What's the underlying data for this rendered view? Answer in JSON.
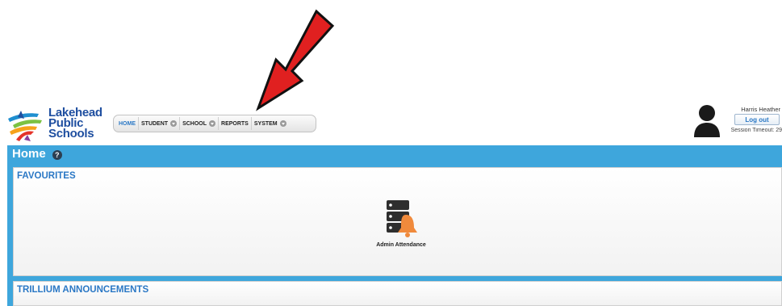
{
  "logo": {
    "line1": "Lakehead",
    "line2": "Public",
    "line3": "Schools"
  },
  "nav": {
    "items": [
      {
        "label": "HOME"
      },
      {
        "label": "STUDENT"
      },
      {
        "label": "SCHOOL"
      },
      {
        "label": "REPORTS"
      },
      {
        "label": "SYSTEM"
      }
    ]
  },
  "user": {
    "name": "Harris Heather",
    "logout_label": "Log out",
    "session_timeout": "Session Timeout: 29"
  },
  "page": {
    "title": "Home",
    "help_icon_text": "?"
  },
  "favourites": {
    "title": "FAVOURITES",
    "items": [
      {
        "label": "Admin Attendance",
        "icon": "server-bell-icon"
      }
    ]
  },
  "announcements": {
    "title": "TRILLIUM ANNOUNCEMENTS"
  },
  "colors": {
    "accent": "#3ea6dc",
    "link": "#2b78c5",
    "arrow": "#e02020",
    "bell": "#f08a3c"
  }
}
